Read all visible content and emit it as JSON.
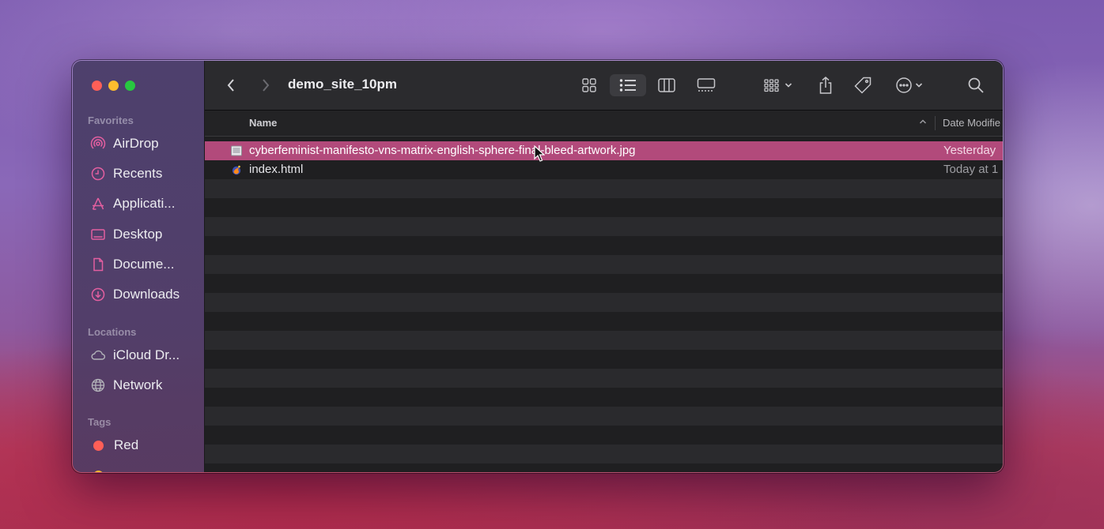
{
  "window": {
    "title": "demo_site_10pm"
  },
  "sidebar": {
    "favorites_label": "Favorites",
    "favorites": [
      {
        "label": "AirDrop",
        "icon": "airdrop-icon"
      },
      {
        "label": "Recents",
        "icon": "clock-icon"
      },
      {
        "label": "Applicati...",
        "icon": "applications-icon"
      },
      {
        "label": "Desktop",
        "icon": "desktop-icon"
      },
      {
        "label": "Docume...",
        "icon": "document-icon"
      },
      {
        "label": "Downloads",
        "icon": "download-icon"
      }
    ],
    "locations_label": "Locations",
    "locations": [
      {
        "label": "iCloud Dr...",
        "icon": "cloud-icon"
      },
      {
        "label": "Network",
        "icon": "globe-icon"
      }
    ],
    "tags_label": "Tags",
    "tags": [
      {
        "label": "Red",
        "color": "#ff5f57"
      }
    ]
  },
  "columns": {
    "name": "Name",
    "date": "Date Modifie"
  },
  "files": [
    {
      "name": "cyberfeminist-manifesto-vns-matrix-english-sphere-final-bleed-artwork.jpg",
      "date": "Yesterday",
      "selected": true,
      "icon": "image-file-icon"
    },
    {
      "name": "index.html",
      "date": "Today at 1",
      "selected": false,
      "icon": "html-file-icon"
    }
  ],
  "colors": {
    "accent": "#e35fa0",
    "selection": "#b24a7b"
  }
}
